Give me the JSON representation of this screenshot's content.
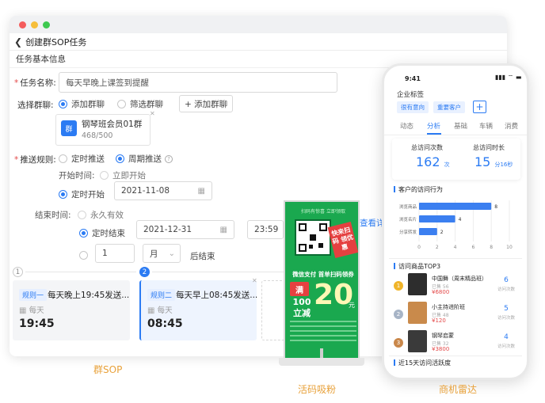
{
  "window": {
    "title": "创建群SOP任务",
    "section_title": "任务基本信息",
    "task_name_label": "任务名称:",
    "task_name_value": "每天早晚上课签到提醒",
    "select_group_label": "选择群聊:",
    "group_opt_add": "添加群聊",
    "group_opt_filter": "筛选群聊",
    "add_group_button": "+ 添加群聊",
    "group_card": {
      "avatar": "群",
      "name": "钢琴班会员01群",
      "count": "468/500"
    },
    "push_rule_label": "推送规则:",
    "push_opt_timed": "定时推送",
    "push_opt_periodic": "周期推送",
    "start_time_label": "开始时间:",
    "start_now": "立即开始",
    "start_timed": "定时开始",
    "start_date": "2021-11-08",
    "end_time_label": "结束时间:",
    "end_forever": "永久有效",
    "end_timed": "定时结束",
    "end_date": "2021-12-31",
    "end_time": "23:59",
    "period_count": "1",
    "period_unit": "月",
    "period_after": "后结束",
    "view_detail": "查看详情"
  },
  "steps": [
    {
      "num": "1",
      "tag": "规则一",
      "title": "每天晚上19:45发送...",
      "day": "每天",
      "time": "19:45"
    },
    {
      "num": "2",
      "tag": "规则二",
      "title": "每天早上08:45发送...",
      "day": "每天",
      "time": "08:45"
    }
  ],
  "captions": {
    "sop": "群SOP",
    "standee": "活码吸粉",
    "radar": "商机雷达"
  },
  "poster": {
    "top_text": "扫码有惊喜 立即领取",
    "sticker": "快来扫码 领优惠",
    "mid_text": "微信支付  首单扫码领券",
    "man": "满",
    "big": "20",
    "yuan": "元",
    "lijian": "100立减"
  },
  "phone": {
    "time": "9:41",
    "signal": "▮▮▮ ⌔ ▬",
    "title": "企业标签",
    "chips": [
      "很有意向",
      "重要客户"
    ],
    "tabs": [
      "动态",
      "分析",
      "基础",
      "车辆",
      "消费"
    ],
    "stats": [
      {
        "label": "总访问次数",
        "value": "162",
        "unit": "次"
      },
      {
        "label": "总访问时长",
        "value": "15",
        "unit": "分16秒"
      }
    ],
    "behavior_title": "客户的访问行为",
    "top3_title": "访问商品TOP3",
    "recent_title": "近15天访问活跃度",
    "products": [
      {
        "rank": "1",
        "name": "中国舞（周末精品班）",
        "sub": "已售 56",
        "price": "¥6800",
        "count": "6",
        "count_label": "访问次数"
      },
      {
        "rank": "2",
        "name": "小主持进阶班",
        "sub": "已售 48",
        "price": "¥120",
        "count": "5",
        "count_label": "访问次数"
      },
      {
        "rank": "3",
        "name": "钢琴启蒙",
        "sub": "已售 32",
        "price": "¥3800",
        "count": "4",
        "count_label": "访问次数"
      }
    ]
  },
  "chart_data": {
    "type": "bar",
    "title": "客户的访问行为",
    "categories": [
      "浏览商品",
      "浏览名片",
      "分享转发"
    ],
    "values": [
      8,
      4,
      2
    ],
    "xlim": [
      0,
      10
    ],
    "xticks": [
      "0",
      "2",
      "4",
      "6",
      "8",
      "10"
    ],
    "orientation": "horizontal",
    "color": "#3b7ff0"
  }
}
